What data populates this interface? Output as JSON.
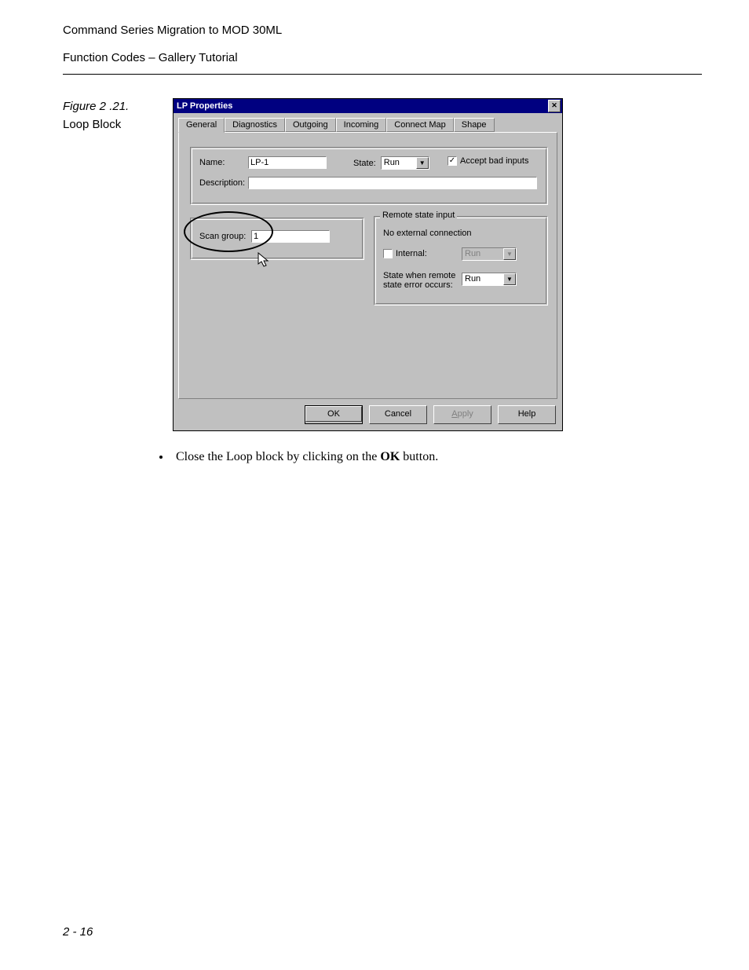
{
  "header": {
    "line1": "Command Series Migration to MOD 30ML",
    "line2": "Function Codes – Gallery Tutorial"
  },
  "figure": {
    "caption": "Figure 2 .21.",
    "sub": "Loop Block"
  },
  "dialog": {
    "title": "LP Properties",
    "tabs": [
      "General",
      "Diagnostics",
      "Outgoing",
      "Incoming",
      "Connect Map",
      "Shape"
    ],
    "active_tab": 0,
    "general": {
      "name_label": "Name:",
      "name_value": "LP-1",
      "state_label": "State:",
      "state_value": "Run",
      "accept_bad_label": "Accept bad inputs",
      "accept_bad_checked": true,
      "description_label": "Description:",
      "description_value": "",
      "scan_group_label": "Scan group:",
      "scan_group_value": "1",
      "remote_group_legend": "Remote state input",
      "remote_no_ext": "No external connection",
      "internal_label": "Internal:",
      "internal_checked": false,
      "internal_value": "Run",
      "state_err_label1": "State when remote",
      "state_err_label2": "state error occurs:",
      "state_err_value": "Run"
    },
    "buttons": {
      "ok": "OK",
      "cancel": "Cancel",
      "apply": "Apply",
      "help": "Help"
    }
  },
  "instruction": {
    "pre": "Close the Loop block by clicking on the ",
    "bold": "OK",
    "post": " button."
  },
  "page_number": "2 - 16"
}
